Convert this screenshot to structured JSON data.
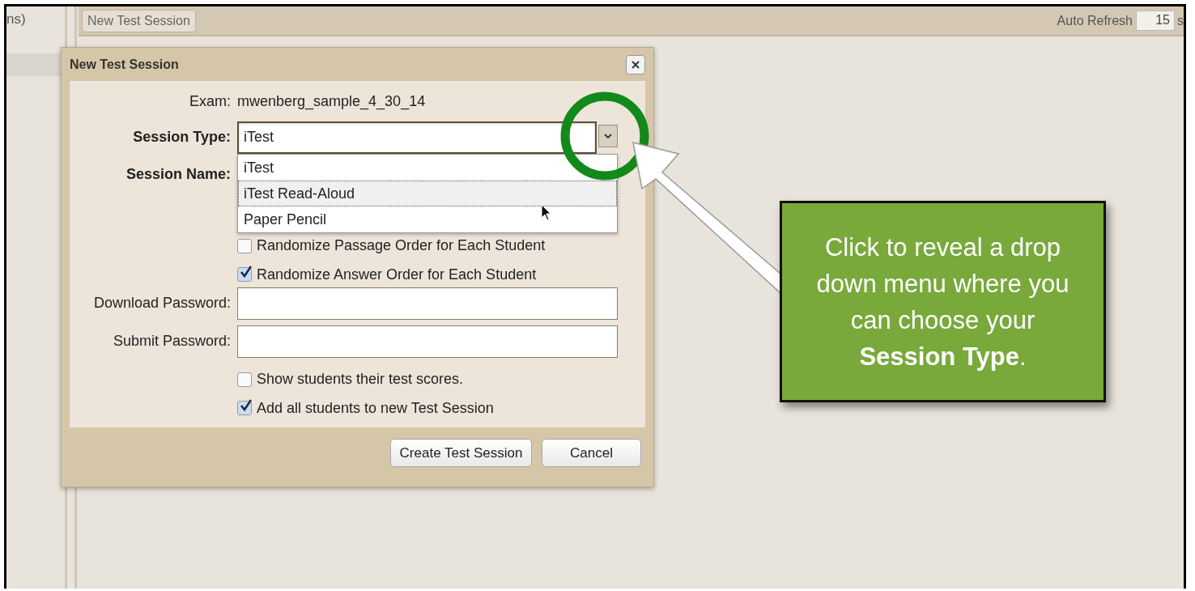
{
  "sidebar": {
    "text": "ns)"
  },
  "toolbar": {
    "new_session_button": "New Test Session",
    "auto_refresh_label": "Auto Refresh",
    "auto_refresh_value": "15",
    "unit": "s"
  },
  "dialog": {
    "title": "New Test Session",
    "exam_label": "Exam:",
    "exam_value": "mwenberg_sample_4_30_14",
    "session_type": {
      "label": "Session Type:",
      "value": "iTest",
      "expanded": true,
      "options": [
        {
          "label": "iTest",
          "highlighted": false
        },
        {
          "label": "iTest Read-Aloud",
          "highlighted": true
        },
        {
          "label": "Paper Pencil",
          "highlighted": false
        }
      ]
    },
    "session_name_label": "Session Name:",
    "fields": [
      {
        "kind": "checkbox",
        "label": "Randomize Passage Order for Each Student",
        "checked": false
      },
      {
        "kind": "checkbox",
        "label": "Randomize Answer Order for Each Student",
        "checked": true
      },
      {
        "kind": "password",
        "label": "Download Password:"
      },
      {
        "kind": "password",
        "label": "Submit Password:"
      },
      {
        "kind": "checkbox",
        "label": "Show students their test scores.",
        "checked": false
      },
      {
        "kind": "checkbox",
        "label": "Add all students to new Test Session",
        "checked": true
      }
    ],
    "buttons": [
      "Create Test Session",
      "Cancel"
    ]
  },
  "callout": {
    "text": "Click to reveal a drop down menu where you can choose your **Session Type**."
  }
}
